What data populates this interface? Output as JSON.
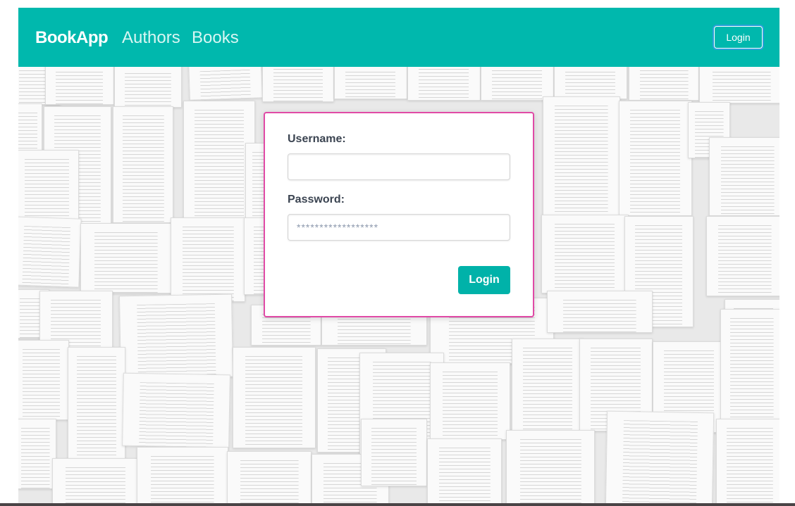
{
  "navbar": {
    "brand": "BookApp",
    "links": [
      {
        "label": "Authors"
      },
      {
        "label": "Books"
      }
    ],
    "login_button": "Login",
    "color": "#00b8ad"
  },
  "login_form": {
    "username_label": "Username:",
    "username_value": "",
    "password_label": "Password:",
    "password_placeholder": "******************",
    "submit_label": "Login",
    "border_color": "#e04aa6",
    "button_color": "#00b2a9"
  }
}
